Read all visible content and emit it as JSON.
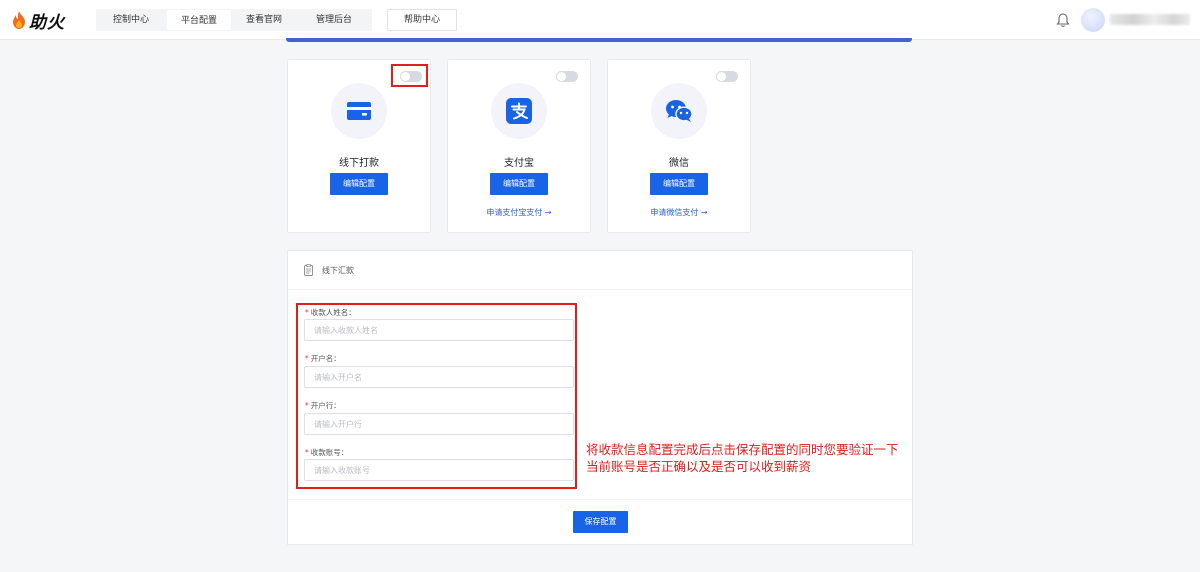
{
  "app": {
    "logo_text": "助火",
    "logo_icon": "flame-icon"
  },
  "nav": {
    "items": [
      "控制中心",
      "平台配置",
      "查看官网",
      "管理后台"
    ],
    "active_index": 1,
    "help_label": "帮助中心"
  },
  "header_right": {
    "bell_icon": "bell-icon",
    "avatar_icon": "avatar"
  },
  "payment_methods": [
    {
      "title": "线下打款",
      "icon": "bank-card-icon",
      "edit_label": "编辑配置",
      "enabled": false,
      "apply_link": ""
    },
    {
      "title": "支付宝",
      "icon": "alipay-icon",
      "edit_label": "编辑配置",
      "enabled": false,
      "apply_link": "申请支付宝支付 →"
    },
    {
      "title": "微信",
      "icon": "wechat-icon",
      "edit_label": "编辑配置",
      "enabled": false,
      "apply_link": "申请微信支付 →"
    }
  ],
  "form": {
    "title": "线下汇款",
    "fields": [
      {
        "label": "收款人姓名：",
        "required": true,
        "value": "",
        "placeholder": "请输入收款人姓名"
      },
      {
        "label": "开户名：",
        "required": true,
        "value": "",
        "placeholder": "请输入开户名"
      },
      {
        "label": "开户行：",
        "required": true,
        "value": "",
        "placeholder": "请输入开户行"
      },
      {
        "label": "收款账号：",
        "required": true,
        "value": "",
        "placeholder": "请输入收款账号"
      }
    ],
    "save_label": "保存配置"
  },
  "annotation": {
    "line1": "将收款信息配置完成后点击保存配置的同时您要验证一下",
    "line2": "当前账号是否正确以及是否可以收到薪资"
  },
  "colors": {
    "primary": "#1964e6",
    "accent_line": "#4063d8",
    "annotation_red": "#e11d1d",
    "required_star": "#e53935"
  }
}
